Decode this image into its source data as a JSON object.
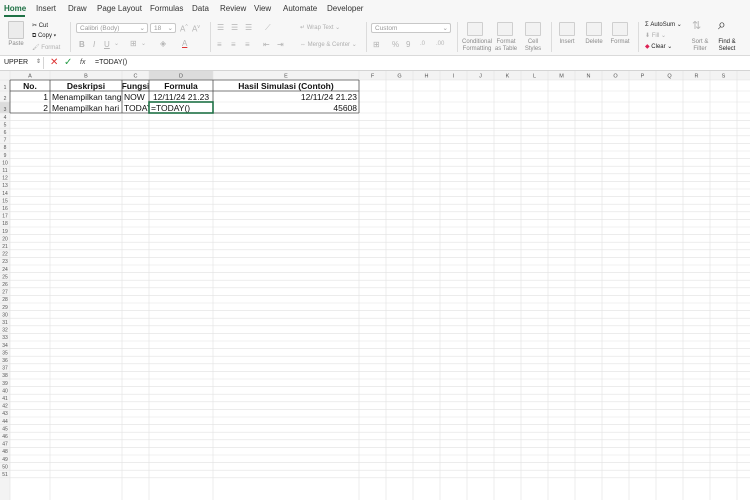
{
  "tabs": [
    "Home",
    "Insert",
    "Draw",
    "Page Layout",
    "Formulas",
    "Data",
    "Review",
    "View",
    "Automate",
    "Developer"
  ],
  "ribbon": {
    "paste": "Paste",
    "cut": "Cut",
    "copy": "Copy",
    "format_painter": "Format",
    "font_name": "Calibri (Body)",
    "font_size": "18",
    "wrap_text": "Wrap Text",
    "merge_center": "Merge & Center",
    "number_format": "Custom",
    "conditional_formatting": [
      "Conditional",
      "Formatting"
    ],
    "format_as_table": [
      "Format",
      "as Table"
    ],
    "cell_styles": [
      "Cell",
      "Styles"
    ],
    "insert": "Insert",
    "delete": "Delete",
    "format": "Format",
    "autosum": "AutoSum",
    "fill": "Fill",
    "clear": "Clear",
    "sort_filter": [
      "Sort &",
      "Filter"
    ],
    "find_select": [
      "Find &",
      "Select"
    ]
  },
  "formula_bar": {
    "name_box": "UPPER",
    "fx": "fx",
    "content": "=TODAY()"
  },
  "sheet": {
    "columns": [
      "A",
      "B",
      "C",
      "D",
      "E",
      "F",
      "G",
      "H",
      "I",
      "J",
      "K",
      "L",
      "M",
      "N",
      "O",
      "P",
      "Q",
      "R",
      "S"
    ],
    "row_count": 51,
    "active_cell": "D3",
    "cells": [
      {
        "ref": "A1",
        "text": "No.",
        "bold": true,
        "align": "center"
      },
      {
        "ref": "B1",
        "text": "Deskripsi",
        "bold": true,
        "align": "center"
      },
      {
        "ref": "C1",
        "text": "Fungsi",
        "bold": true,
        "align": "center"
      },
      {
        "ref": "D1",
        "text": "Formula",
        "bold": true,
        "align": "center"
      },
      {
        "ref": "E1",
        "text": "Hasil Simulasi (Contoh)",
        "bold": true,
        "align": "center"
      },
      {
        "ref": "A2",
        "text": "1",
        "align": "right"
      },
      {
        "ref": "B2",
        "text": "Menampilkan tanggal",
        "align": "left"
      },
      {
        "ref": "C2",
        "text": "NOW",
        "align": "left"
      },
      {
        "ref": "D2",
        "text": "12/11/24 21.23",
        "align": "center"
      },
      {
        "ref": "E2",
        "text": "12/11/24 21.23",
        "align": "right"
      },
      {
        "ref": "A3",
        "text": "2",
        "align": "right"
      },
      {
        "ref": "B3",
        "text": "Menampilkan hari ini",
        "align": "left"
      },
      {
        "ref": "C3",
        "text": "TODAY",
        "align": "left"
      },
      {
        "ref": "D3",
        "text": "=TODAY()",
        "align": "left"
      },
      {
        "ref": "E3",
        "text": "45608",
        "align": "right"
      }
    ]
  }
}
